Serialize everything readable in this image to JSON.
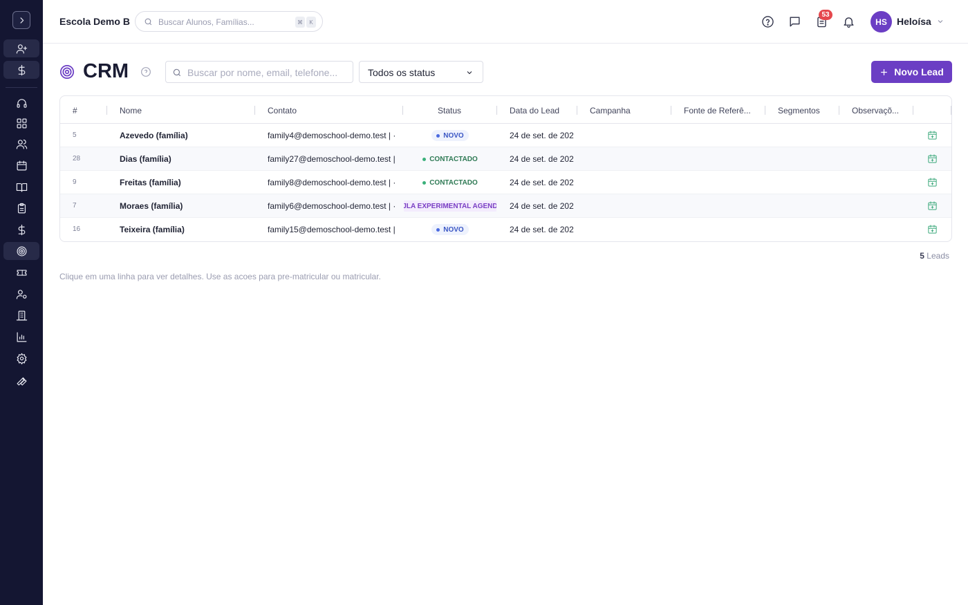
{
  "header": {
    "school_name": "Escola Demo B",
    "search_placeholder": "Buscar Alunos, Famílias...",
    "shortcut_keys": [
      "⌘",
      "K"
    ],
    "tasks_badge": "53",
    "user_initials": "HS",
    "user_name": "Heloísa"
  },
  "page": {
    "title": "CRM",
    "search_placeholder": "Buscar por nome, email, telefone...",
    "status_filter": "Todos os status",
    "new_lead_label": "Novo Lead"
  },
  "table": {
    "columns": [
      "#",
      "Nome",
      "Contato",
      "Status",
      "Data do Lead",
      "Campanha",
      "Fonte de Referê...",
      "Segmentos",
      "Observaçõ..."
    ],
    "rows": [
      {
        "id": "5",
        "name": "Azevedo (família)",
        "contact": "family4@demoschool-demo.test | ·",
        "status": "NOVO",
        "status_kind": "novo",
        "date": "24 de set. de 202"
      },
      {
        "id": "28",
        "name": "Dias (família)",
        "contact": "family27@demoschool-demo.test |",
        "status": "CONTACTADO",
        "status_kind": "contact",
        "date": "24 de set. de 202"
      },
      {
        "id": "9",
        "name": "Freitas (família)",
        "contact": "family8@demoschool-demo.test | ·",
        "status": "CONTACTADO",
        "status_kind": "contact",
        "date": "24 de set. de 202"
      },
      {
        "id": "7",
        "name": "Moraes (família)",
        "contact": "family6@demoschool-demo.test | ·",
        "status": "JLA EXPERIMENTAL AGEND",
        "status_kind": "aula",
        "date": "24 de set. de 202"
      },
      {
        "id": "16",
        "name": "Teixeira (família)",
        "contact": "family15@demoschool-demo.test |",
        "status": "NOVO",
        "status_kind": "novo",
        "date": "24 de set. de 202"
      }
    ]
  },
  "footer": {
    "lead_count": "5",
    "lead_count_label": "Leads",
    "hint": "Clique em uma linha para ver detalhes. Use as acoes para pre-matricular ou matricular."
  },
  "colors": {
    "sidebar_bg": "#141632",
    "accent": "#6b3ec4",
    "badge": "#e5484d",
    "status_new": "#3a56c4",
    "status_contacted": "#2f7a55",
    "action_icon": "#3aa87a"
  }
}
